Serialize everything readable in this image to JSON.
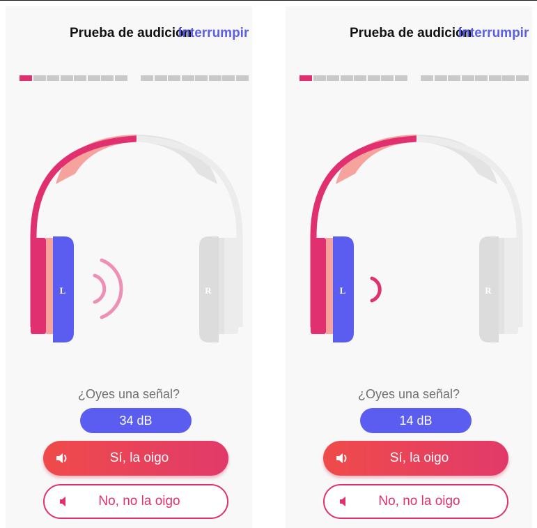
{
  "header": {
    "title": "Prueba de audición",
    "action_label": "Interrumpir"
  },
  "progress": {
    "left_group_segments": 8,
    "right_group_segments": 8,
    "completed": 1
  },
  "headphone": {
    "left_label": "L",
    "right_label": "R"
  },
  "screens": [
    {
      "question": "¿Oyes una señal?",
      "level": "34 dB",
      "sound_waves": 2
    },
    {
      "question": "¿Oyes una señal?",
      "level": "14 dB",
      "sound_waves": 1
    }
  ],
  "buttons": {
    "yes_label": "Sí, la oigo",
    "no_label": "No, no la oigo",
    "yes_icon": "speaker-loud-icon",
    "no_icon": "speaker-quiet-icon"
  },
  "colors": {
    "accent_pink": "#e0306f",
    "light_pink": "#f6a39e",
    "accent_blue": "#5b5cf0",
    "inactive_gray": "#dcdcdc"
  }
}
